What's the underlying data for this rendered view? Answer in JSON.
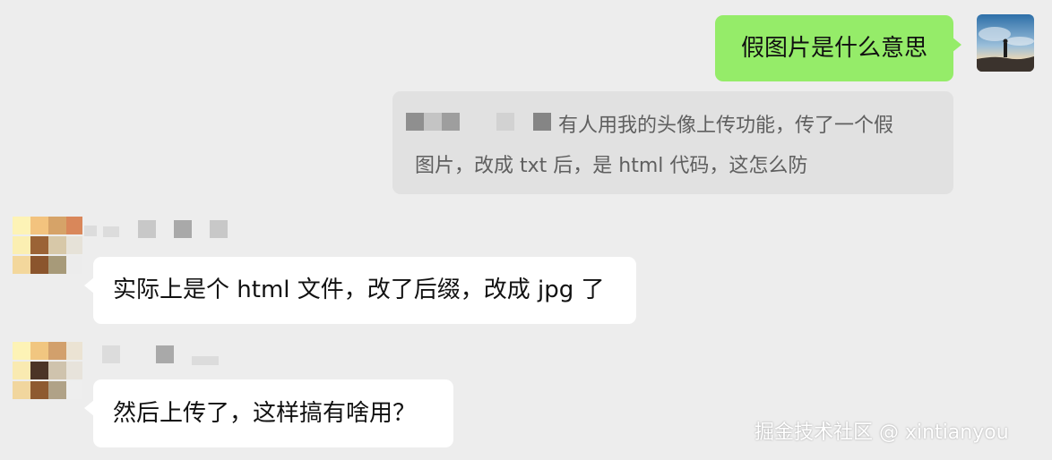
{
  "messages": {
    "outgoing": {
      "text": "假图片是什么意思"
    },
    "quote": {
      "line1": "有人用我的头像上传功能，传了一个假",
      "line2": "图片，改成 txt 后，是 html 代码，这怎么防"
    },
    "incoming": [
      {
        "text": "实际上是个 html 文件，改了后缀，改成 jpg 了"
      },
      {
        "text": "然后上传了，这样搞有啥用？"
      }
    ]
  },
  "watermark": "掘金技术社区 @ xintianyou",
  "colors": {
    "background": "#ededed",
    "outgoing_bubble": "#95ec69",
    "incoming_bubble": "#ffffff",
    "quote_block": "#e1e1e1"
  }
}
